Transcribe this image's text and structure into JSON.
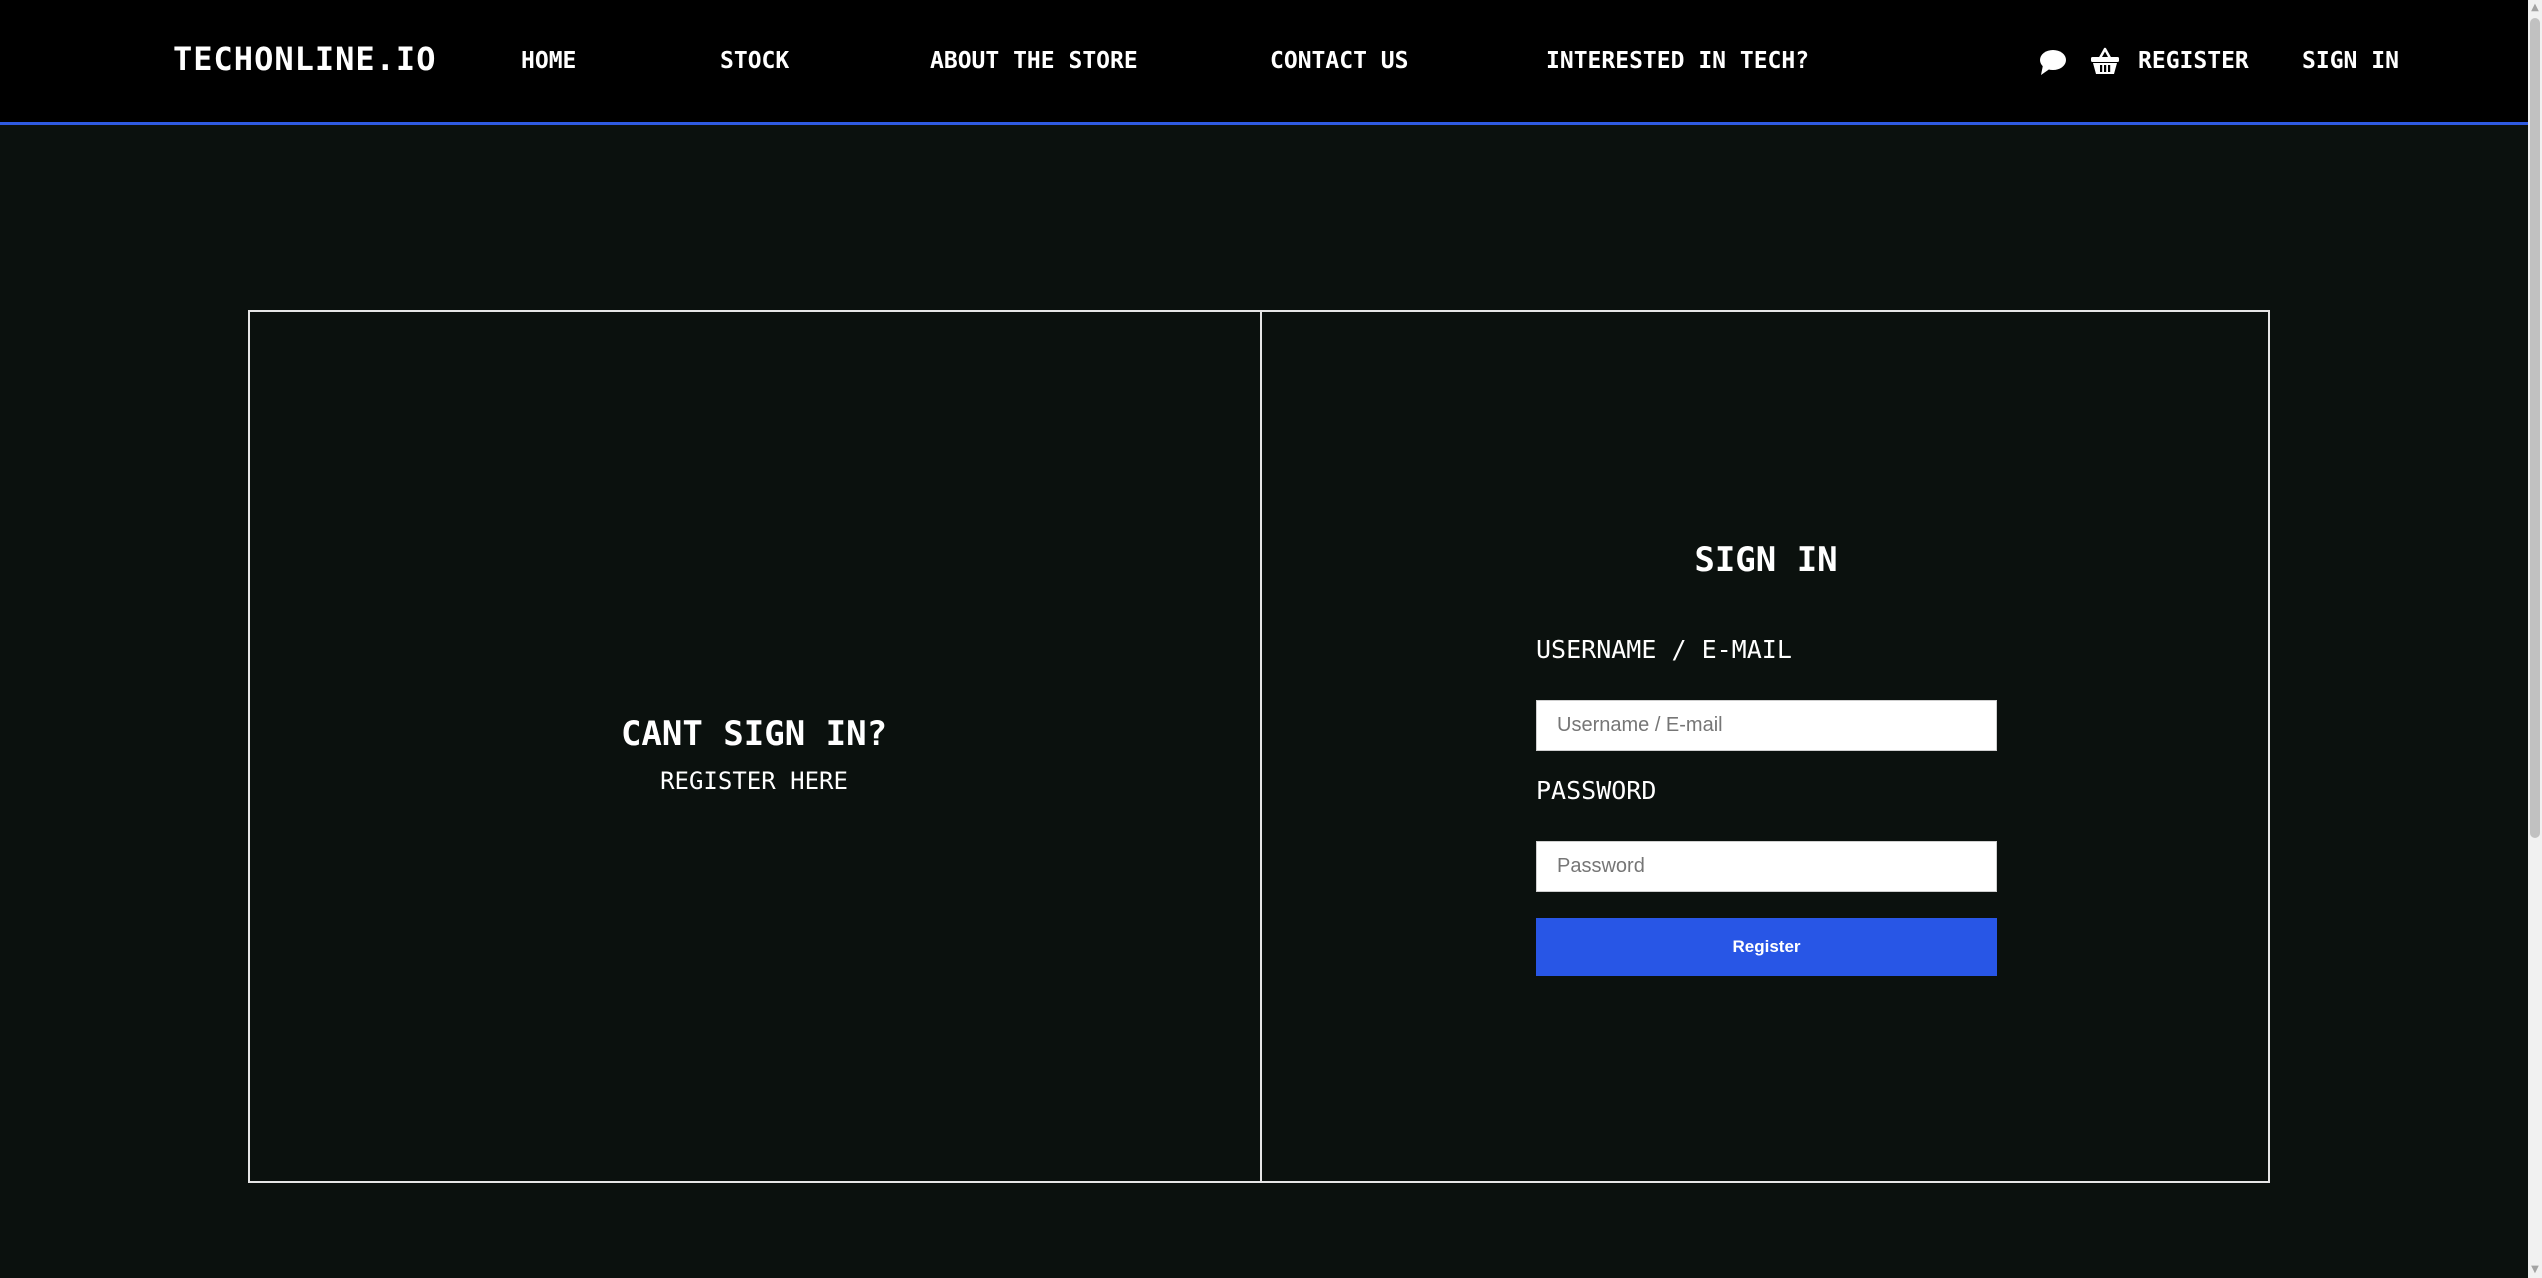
{
  "navbar": {
    "brand": "TECHONLINE.IO",
    "links": [
      {
        "label": "HOME"
      },
      {
        "label": "STOCK"
      },
      {
        "label": "ABOUT THE STORE"
      },
      {
        "label": "CONTACT US"
      },
      {
        "label": "INTERESTED IN TECH?"
      }
    ],
    "icons": [
      "chat-icon",
      "basket-icon"
    ],
    "register_label": "REGISTER",
    "signin_label": "SIGN IN",
    "accent_color": "#2f5be0"
  },
  "left_panel": {
    "title": "CANT SIGN IN?",
    "register_link": "REGISTER HERE"
  },
  "signin_form": {
    "title": "SIGN IN",
    "username_label": "USERNAME / E-MAIL",
    "username_placeholder": "Username / E-mail",
    "password_label": "PASSWORD",
    "password_placeholder": "Password",
    "submit_label": "Register",
    "button_color": "#2856e6"
  },
  "colors": {
    "background": "#0b110e",
    "navbar_background": "#000000",
    "panel_border": "#e6e6e6"
  }
}
